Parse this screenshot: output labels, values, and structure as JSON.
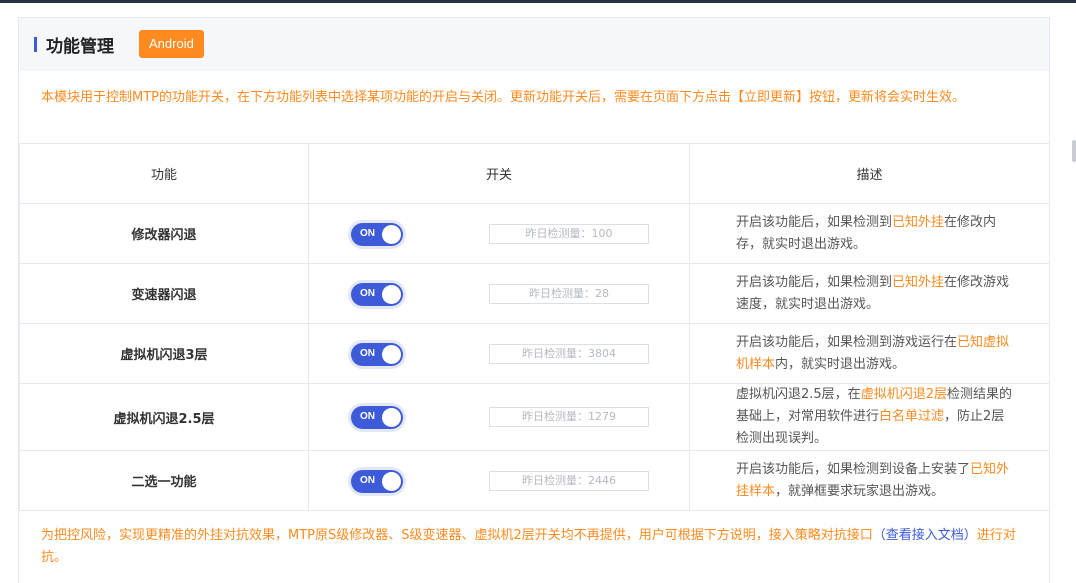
{
  "header": {
    "title": "功能管理",
    "badge": "Android"
  },
  "notice_top": "本模块用于控制MTP的功能开关，在下方功能列表中选择某项功能的开启与关闭。更新功能开关后，需要在页面下方点击【立即更新】按钮，更新将会实时生效。",
  "table": {
    "columns": [
      "功能",
      "开关",
      "描述"
    ],
    "rows": [
      {
        "name": "修改器闪退",
        "toggle": "ON",
        "count_text": "昨日检测量：100",
        "desc": [
          {
            "t": "开启该功能后，如果检测到"
          },
          {
            "t": "已知外挂",
            "hl": true
          },
          {
            "t": "在修改内存，就实时退出游戏。"
          }
        ]
      },
      {
        "name": "变速器闪退",
        "toggle": "ON",
        "count_text": "昨日检测量：28",
        "desc": [
          {
            "t": "开启该功能后，如果检测到"
          },
          {
            "t": "已知外挂",
            "hl": true
          },
          {
            "t": "在修改游戏速度，就实时退出游戏。"
          }
        ]
      },
      {
        "name": "虚拟机闪退3层",
        "toggle": "ON",
        "count_text": "昨日检测量：3804",
        "desc": [
          {
            "t": "开启该功能后，如果检测到游戏运行在"
          },
          {
            "t": "已知虚拟机样本",
            "hl": true
          },
          {
            "t": "内，就实时退出游戏。"
          }
        ]
      },
      {
        "name": "虚拟机闪退2.5层",
        "toggle": "ON",
        "count_text": "昨日检测量：1279",
        "desc": [
          {
            "t": "虚拟机闪退2.5层，在"
          },
          {
            "t": "虚拟机闪退2层",
            "hl": true
          },
          {
            "t": "检测结果的基础上，对常用软件进行"
          },
          {
            "t": "白名单过滤",
            "hl": true
          },
          {
            "t": "，防止2层检测出现误判。"
          }
        ]
      },
      {
        "name": "二选一功能",
        "toggle": "ON",
        "count_text": "昨日检测量：2446",
        "desc": [
          {
            "t": "开启该功能后，如果检测到设备上安装了"
          },
          {
            "t": "已知外挂样本",
            "hl": true
          },
          {
            "t": "，就弹框要求玩家退出游戏。"
          }
        ]
      }
    ]
  },
  "notice_bottom": {
    "text_before": "为把控风险，实现更精准的外挂对抗效果，MTP原S级修改器、S级变速器、虚拟机2层开关均不再提供，用户可根据下方说明，接入策略对抗接口",
    "link": "（查看接入文档）",
    "text_after": "进行对抗。"
  },
  "colors": {
    "accent": "#3d5bd9",
    "warning": "#ff8a1f"
  }
}
